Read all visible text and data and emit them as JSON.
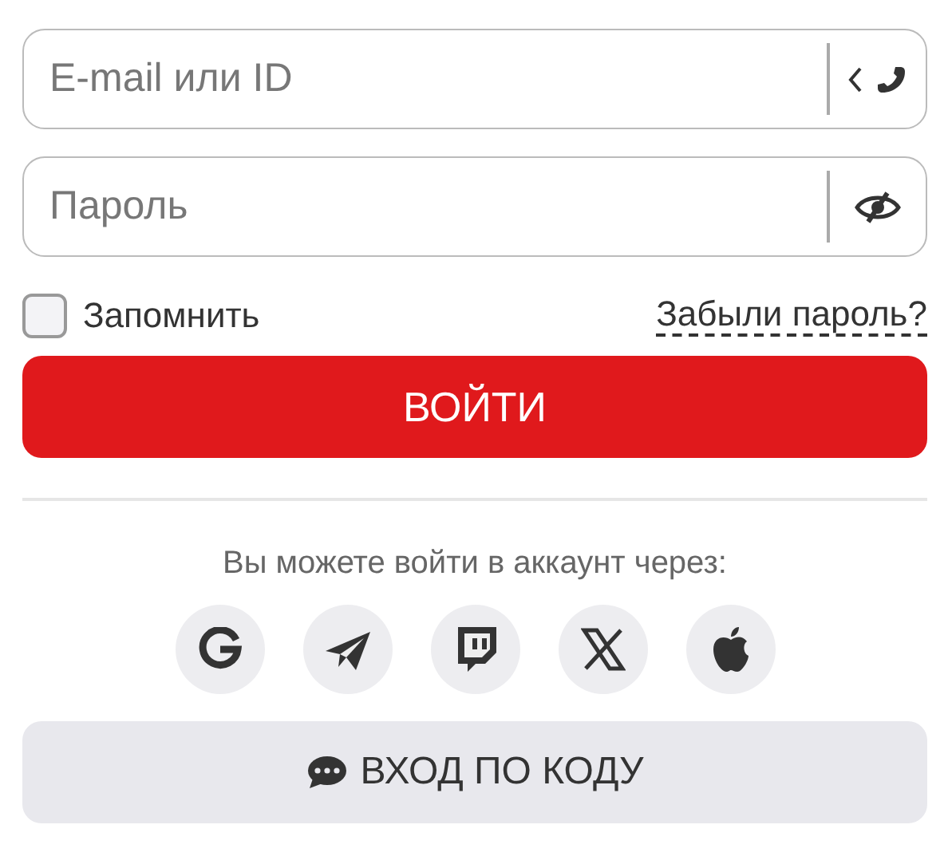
{
  "login_field": {
    "placeholder": "E-mail или ID"
  },
  "password_field": {
    "placeholder": "Пароль"
  },
  "remember": {
    "label": "Запомнить",
    "checked": false
  },
  "forgot_link": "Забыли пароль?",
  "login_button": "ВОЙТИ",
  "social_caption": "Вы можете войти в аккаунт через:",
  "code_button": "ВХОД ПО КОДУ"
}
